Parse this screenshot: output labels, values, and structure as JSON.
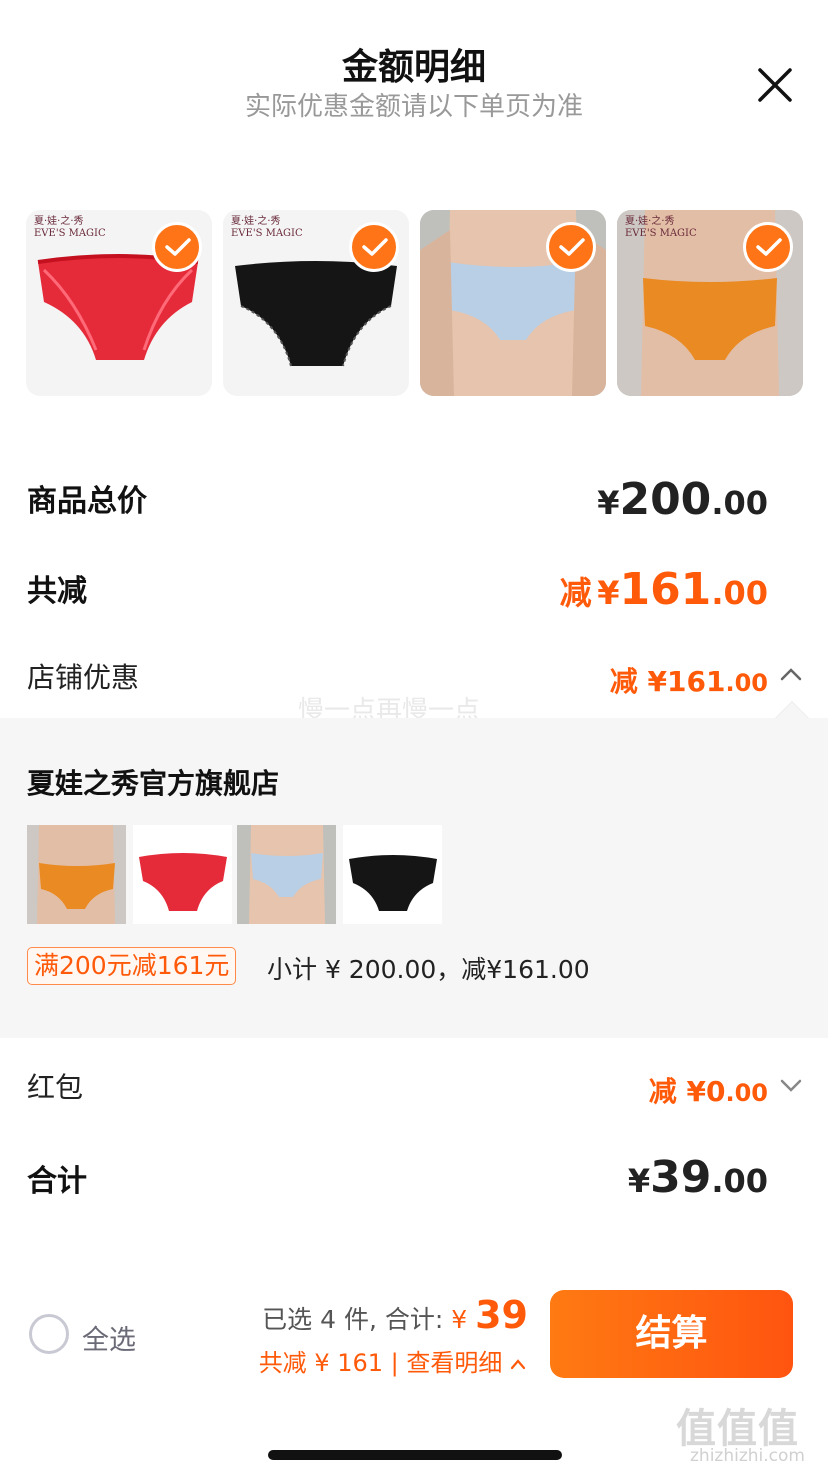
{
  "header": {
    "title": "金额明细",
    "subtitle": "实际优惠金额请以下单页为准",
    "close_icon": "close-icon"
  },
  "products": [
    {
      "name": "red-lace-brief",
      "brand": "夏·娃·之·秀\nEVE'S MAGIC",
      "color": "#e52a3a",
      "checked": true
    },
    {
      "name": "black-brief",
      "brand": "夏·娃·之·秀\nEVE'S MAGIC",
      "color": "#151515",
      "checked": true
    },
    {
      "name": "light-blue-brief",
      "brand": "",
      "color": "#b9cfe6",
      "checked": true
    },
    {
      "name": "orange-brief",
      "brand": "夏·娃·之·秀\nEVE'S MAGIC",
      "color": "#ea8a22",
      "checked": true
    }
  ],
  "summary": {
    "total_label": "商品总价",
    "total_currency": "¥",
    "total_int": "200",
    "total_dec": ".00",
    "discount_label": "共减",
    "discount_prefix": "减",
    "discount_currency": "¥",
    "discount_int": "161",
    "discount_dec": ".00",
    "store_label": "店铺优惠",
    "store_prefix": "减",
    "store_currency": "¥",
    "store_int": "161",
    "store_dec": ".00"
  },
  "watermark": "慢一点再慢一点",
  "shop": {
    "name": "夏娃之秀官方旗舰店",
    "promo_tag": "满200元减161元",
    "subtotal": "小计 ¥ 200.00，减¥161.00",
    "mini_brand": "夏·娃·之·秀\nEVE'S MAGIC"
  },
  "red_packet": {
    "label": "红包",
    "prefix": "减",
    "currency": "¥",
    "int": "0",
    "dec": ".00"
  },
  "grand_total": {
    "label": "合计",
    "currency": "¥",
    "int": "39",
    "dec": ".00"
  },
  "bottom_bar": {
    "select_all": "全选",
    "selected_text": "已选 4 件, 合计: ",
    "currency": "¥ ",
    "amount": "39",
    "save_text": "共减 ¥ 161 | 查看明细 ",
    "checkout": "结算"
  },
  "site_watermark": {
    "logo": "值值值",
    "url": "zhizhizhi.com"
  },
  "colors": {
    "accent": "#ff5a0a",
    "check_badge": "#ff7417",
    "shop_bg": "#f6f6f6"
  }
}
